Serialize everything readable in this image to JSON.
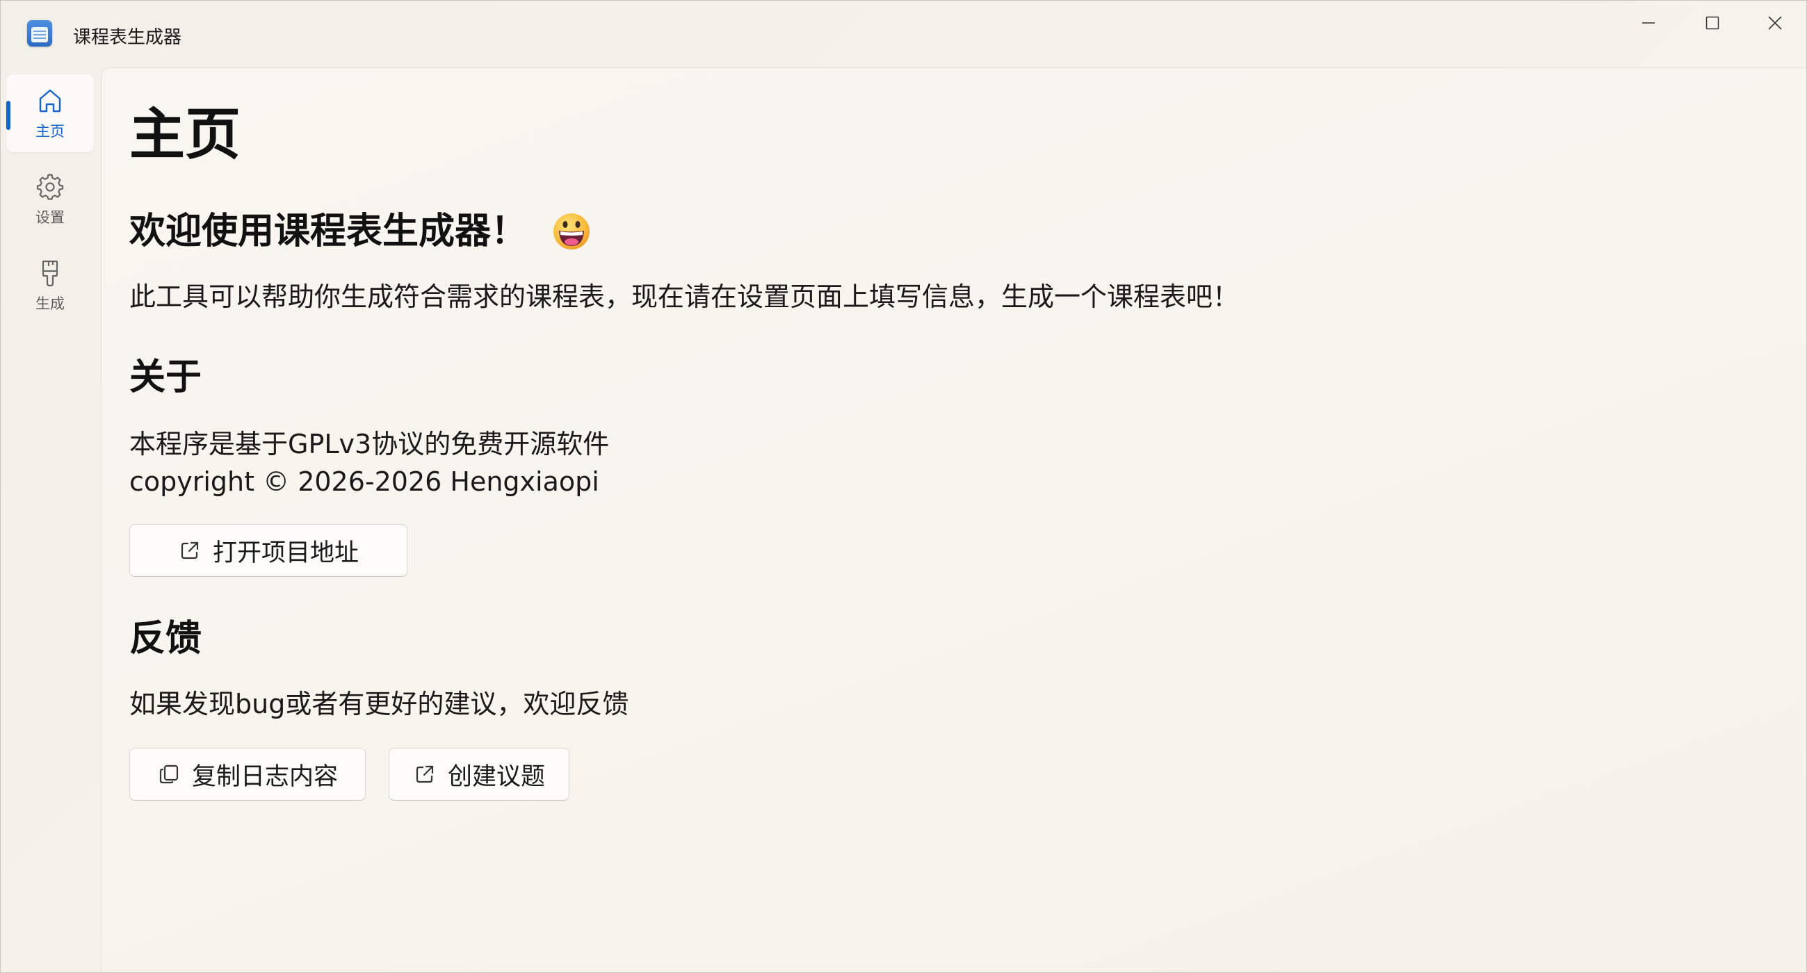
{
  "window": {
    "title": "课程表生成器",
    "controls": {
      "minimize_icon": "minimize-icon",
      "maximize_icon": "maximize-icon",
      "close_icon": "close-icon"
    }
  },
  "sidebar": {
    "items": [
      {
        "label": "主页",
        "icon": "home-icon",
        "active": true
      },
      {
        "label": "设置",
        "icon": "gear-icon",
        "active": false
      },
      {
        "label": "生成",
        "icon": "brush-icon",
        "active": false
      }
    ],
    "accent": "#1565c8"
  },
  "main": {
    "page_title": "主页",
    "welcome": {
      "heading": "欢迎使用课程表生成器！",
      "emoji_icon": "grinning-face-icon",
      "text": "此工具可以帮助你生成符合需求的课程表，现在请在设置页面上填写信息，生成一个课程表吧！"
    },
    "about": {
      "heading": "关于",
      "license_text": "本程序是基于GPLv3协议的免费开源软件",
      "copyright_text": "copyright © 2026-2026 Hengxiaopi",
      "open_repo_button": "打开项目地址"
    },
    "feedback": {
      "heading": "反馈",
      "text": "如果发现bug或者有更好的建议，欢迎反馈",
      "copy_log_button": "复制日志内容",
      "create_issue_button": "创建议题"
    }
  }
}
